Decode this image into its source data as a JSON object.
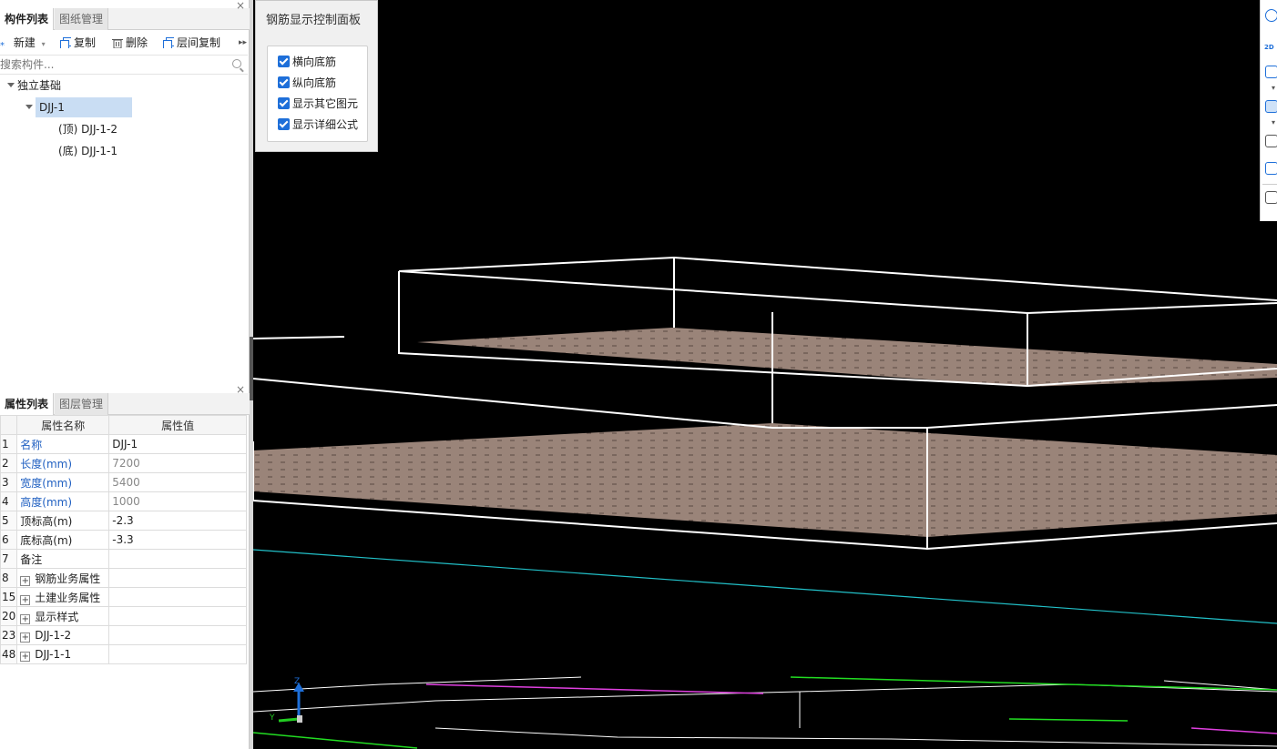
{
  "component_panel": {
    "tabs": [
      "构件列表",
      "图纸管理"
    ],
    "toolbar": {
      "new_label": "新建",
      "copy_label": "复制",
      "delete_label": "删除",
      "floor_copy_label": "层间复制"
    },
    "search_placeholder": "搜索构件...",
    "tree": {
      "root": "独立基础",
      "item": "DJJ-1",
      "children": [
        "(顶)  DJJ-1-2",
        "(底)  DJJ-1-1"
      ]
    }
  },
  "property_panel": {
    "tabs": [
      "属性列表",
      "图层管理"
    ],
    "headers": [
      "属性名称",
      "属性值"
    ],
    "rows": [
      {
        "num": "1",
        "name": "名称",
        "value": "DJJ-1",
        "blue": true,
        "grey": false,
        "expand": false
      },
      {
        "num": "2",
        "name": "长度(mm)",
        "value": "7200",
        "blue": true,
        "grey": true,
        "expand": false
      },
      {
        "num": "3",
        "name": "宽度(mm)",
        "value": "5400",
        "blue": true,
        "grey": true,
        "expand": false
      },
      {
        "num": "4",
        "name": "高度(mm)",
        "value": "1000",
        "blue": true,
        "grey": true,
        "expand": false
      },
      {
        "num": "5",
        "name": "顶标高(m)",
        "value": "-2.3",
        "blue": false,
        "grey": false,
        "expand": false
      },
      {
        "num": "6",
        "name": "底标高(m)",
        "value": "-3.3",
        "blue": false,
        "grey": false,
        "expand": false
      },
      {
        "num": "7",
        "name": "备注",
        "value": "",
        "blue": false,
        "grey": false,
        "expand": false
      },
      {
        "num": "8",
        "name": "钢筋业务属性",
        "value": "",
        "blue": false,
        "grey": false,
        "expand": true
      },
      {
        "num": "15",
        "name": "土建业务属性",
        "value": "",
        "blue": false,
        "grey": false,
        "expand": true
      },
      {
        "num": "20",
        "name": "显示样式",
        "value": "",
        "blue": false,
        "grey": false,
        "expand": true
      },
      {
        "num": "23",
        "name": "DJJ-1-2",
        "value": "",
        "blue": false,
        "grey": false,
        "expand": true
      },
      {
        "num": "48",
        "name": "DJJ-1-1",
        "value": "",
        "blue": false,
        "grey": false,
        "expand": true
      }
    ]
  },
  "rebar_panel": {
    "title": "钢筋显示控制面板",
    "options": [
      {
        "label": "横向底筋",
        "checked": true
      },
      {
        "label": "纵向底筋",
        "checked": true
      },
      {
        "label": "显示其它图元",
        "checked": true
      },
      {
        "label": "显示详细公式",
        "checked": true
      }
    ]
  },
  "viewport": {
    "axis_label": "Z",
    "axis_y_label": "Y",
    "colors": {
      "background": "#000000",
      "slab": "#9a8479",
      "wire": "#ffffff",
      "axis_line": "#22c0c8"
    }
  },
  "right_toolbar": {
    "label_2d": "2D"
  }
}
